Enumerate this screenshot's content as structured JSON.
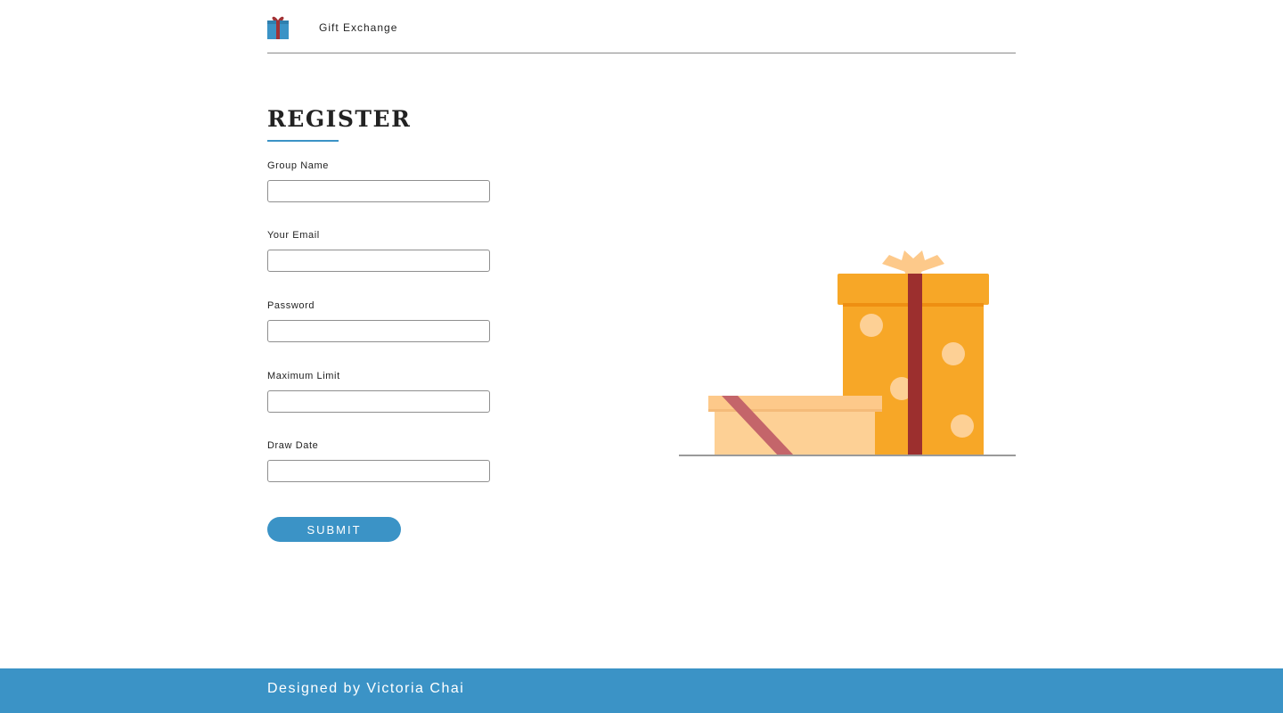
{
  "header": {
    "logo_icon": "gift-icon",
    "site_name": "Gift Exchange"
  },
  "form": {
    "title": "REGISTER",
    "fields": [
      {
        "label": "Group Name",
        "value": ""
      },
      {
        "label": "Your Email",
        "value": ""
      },
      {
        "label": "Password",
        "value": ""
      },
      {
        "label": "Maximum Limit",
        "value": ""
      },
      {
        "label": "Draw Date",
        "value": ""
      }
    ],
    "submit_label": "SUBMIT"
  },
  "illustration": {
    "icon": "gift-boxes-illustration"
  },
  "footer": {
    "credit": "Designed by Victoria Chai"
  },
  "colors": {
    "accent": "#3b93c6",
    "gift_orange": "#f7a727",
    "gift_peach": "#fdd095",
    "ribbon_red": "#9c2f2e",
    "ribbon_rose": "#c4656a"
  }
}
